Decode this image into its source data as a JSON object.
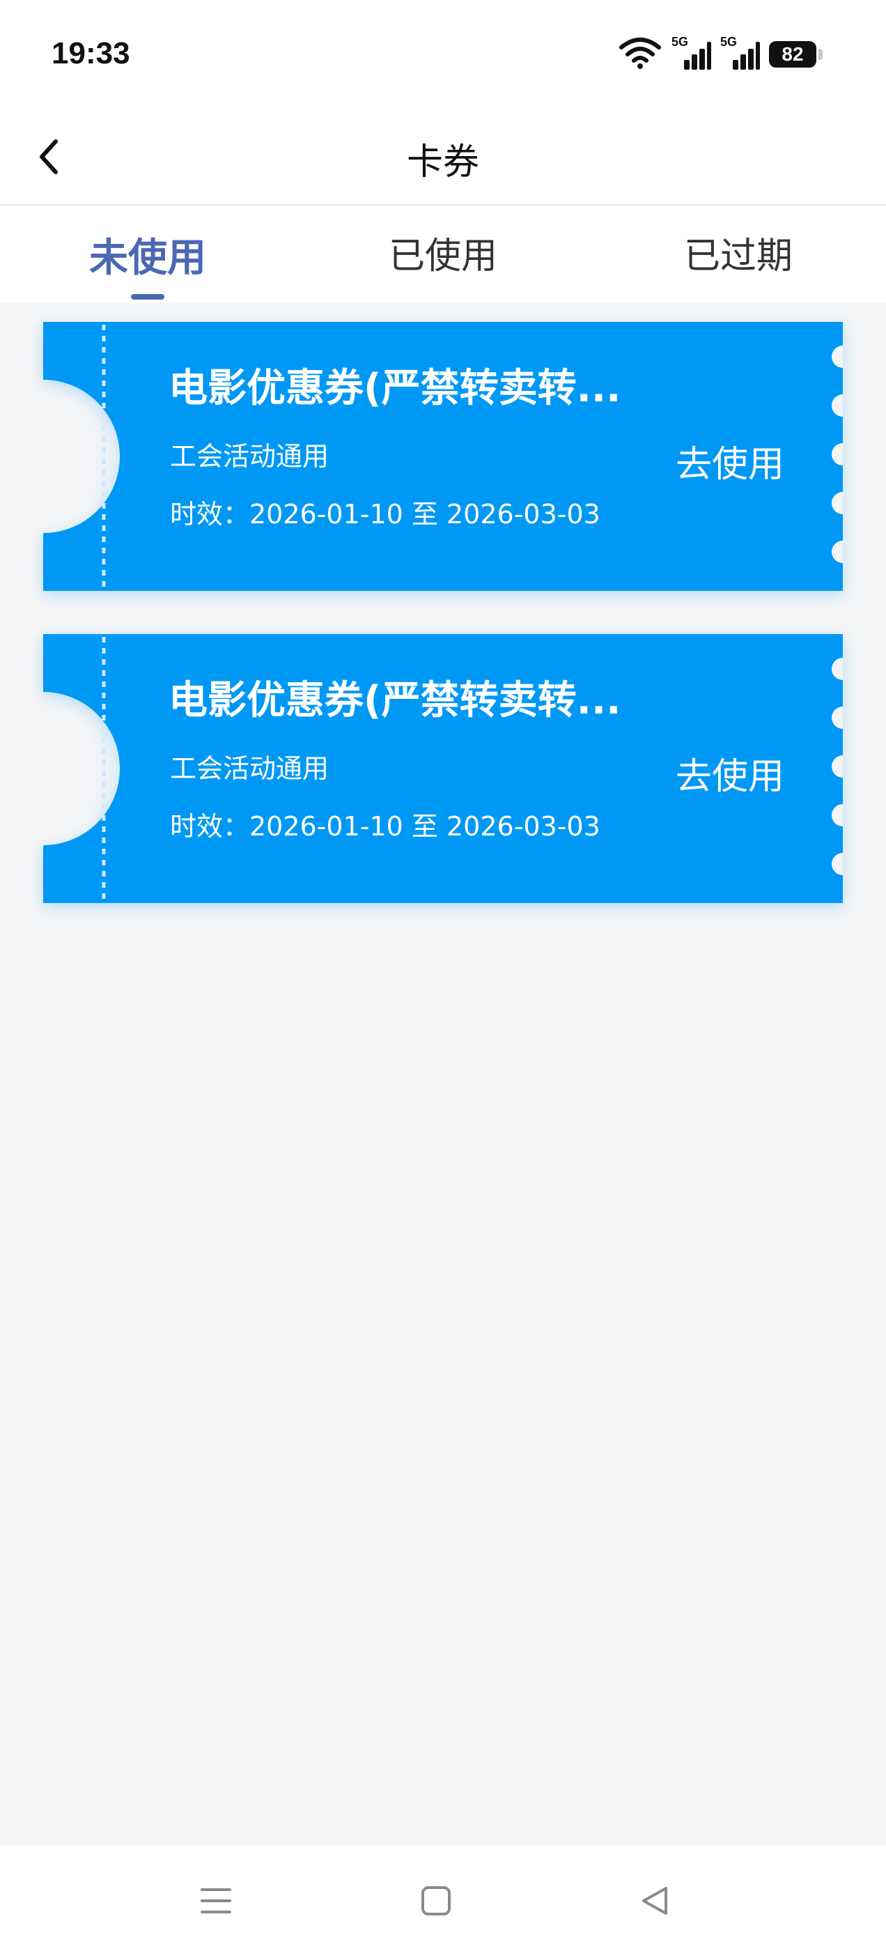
{
  "status_bar": {
    "time": "19:33",
    "signal1_label": "5G",
    "signal2_label": "5G",
    "battery": "82"
  },
  "header": {
    "title": "卡券"
  },
  "tabs": [
    {
      "label": "未使用",
      "active": true
    },
    {
      "label": "已使用",
      "active": false
    },
    {
      "label": "已过期",
      "active": false
    }
  ],
  "coupons": [
    {
      "title": "电影优惠券(严禁转卖转...",
      "scope": "工会活动通用",
      "validity": "时效：2026-01-10 至 2026-03-03",
      "action_label": "去使用"
    },
    {
      "title": "电影优惠券(严禁转卖转...",
      "scope": "工会活动通用",
      "validity": "时效：2026-01-10 至 2026-03-03",
      "action_label": "去使用"
    }
  ],
  "colors": {
    "coupon_bg": "#0098f5",
    "accent": "#4a68b4",
    "page_bg": "#f4f5f6"
  },
  "nav_bar": {
    "icons": [
      "menu-icon",
      "home-square-icon",
      "back-triangle-icon"
    ]
  }
}
